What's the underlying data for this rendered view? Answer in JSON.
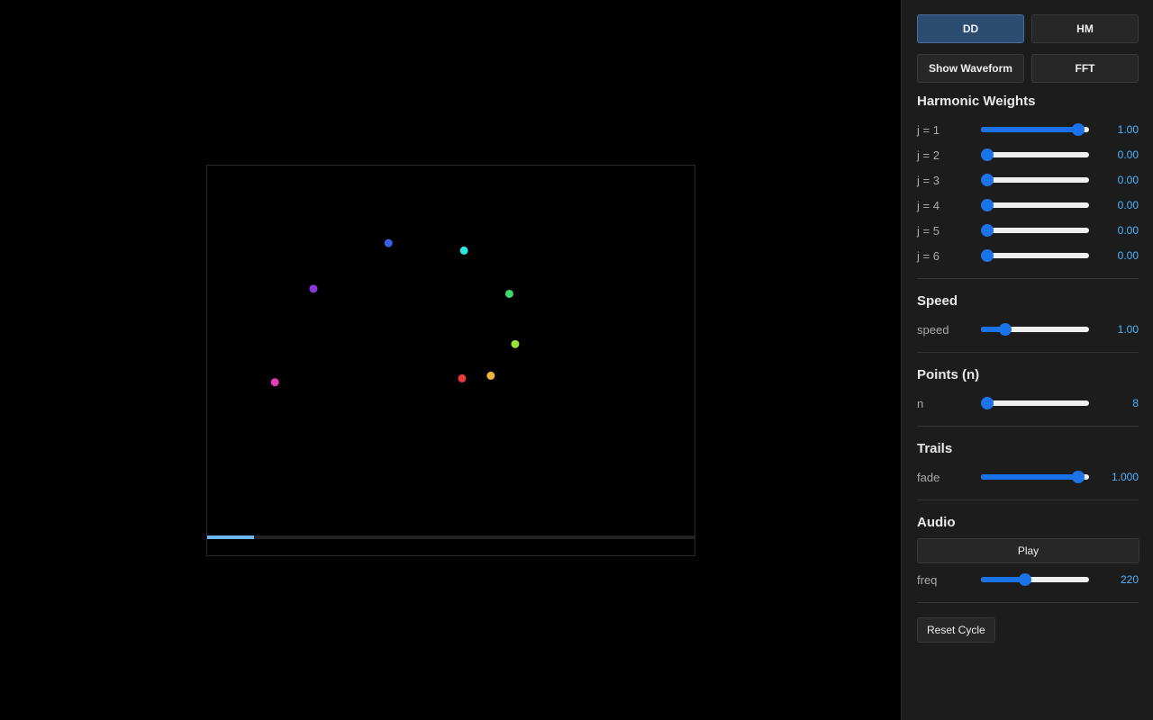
{
  "canvas": {
    "points": [
      {
        "color": "#3b5ee8",
        "fx": 0.372,
        "fy": 0.199
      },
      {
        "color": "#2ee6e0",
        "fx": 0.527,
        "fy": 0.218
      },
      {
        "color": "#8b3ad9",
        "fx": 0.218,
        "fy": 0.316
      },
      {
        "color": "#3bdc6a",
        "fx": 0.62,
        "fy": 0.329
      },
      {
        "color": "#9be03a",
        "fx": 0.632,
        "fy": 0.458
      },
      {
        "color": "#f0b43c",
        "fx": 0.582,
        "fy": 0.539
      },
      {
        "color": "#e83a3a",
        "fx": 0.523,
        "fy": 0.546
      },
      {
        "color": "#e83ab8",
        "fx": 0.139,
        "fy": 0.556
      }
    ],
    "progress": 0.097
  },
  "panel": {
    "mode_buttons": [
      {
        "label": "DD",
        "active": true
      },
      {
        "label": "HM",
        "active": false
      }
    ],
    "view_buttons": [
      {
        "label": "Show Waveform"
      },
      {
        "label": "FFT"
      }
    ],
    "harmonics": {
      "title": "Harmonic Weights",
      "sliders": [
        {
          "label": "j = 1",
          "value": "1.00",
          "frac": 0.95
        },
        {
          "label": "j = 2",
          "value": "0.00",
          "frac": 0.0
        },
        {
          "label": "j = 3",
          "value": "0.00",
          "frac": 0.0
        },
        {
          "label": "j = 4",
          "value": "0.00",
          "frac": 0.0
        },
        {
          "label": "j = 5",
          "value": "0.00",
          "frac": 0.0
        },
        {
          "label": "j = 6",
          "value": "0.00",
          "frac": 0.0
        }
      ]
    },
    "speed": {
      "title": "Speed",
      "label": "speed",
      "value": "1.00",
      "frac": 0.19
    },
    "points": {
      "title": "Points (n)",
      "label": "n",
      "value": "8",
      "frac": 0.0
    },
    "trails": {
      "title": "Trails",
      "label": "fade",
      "value": "1.000",
      "frac": 0.95
    },
    "audio": {
      "title": "Audio",
      "play_label": "Play",
      "label": "freq",
      "value": "220",
      "frac": 0.4
    },
    "reset_label": "Reset Cycle"
  }
}
